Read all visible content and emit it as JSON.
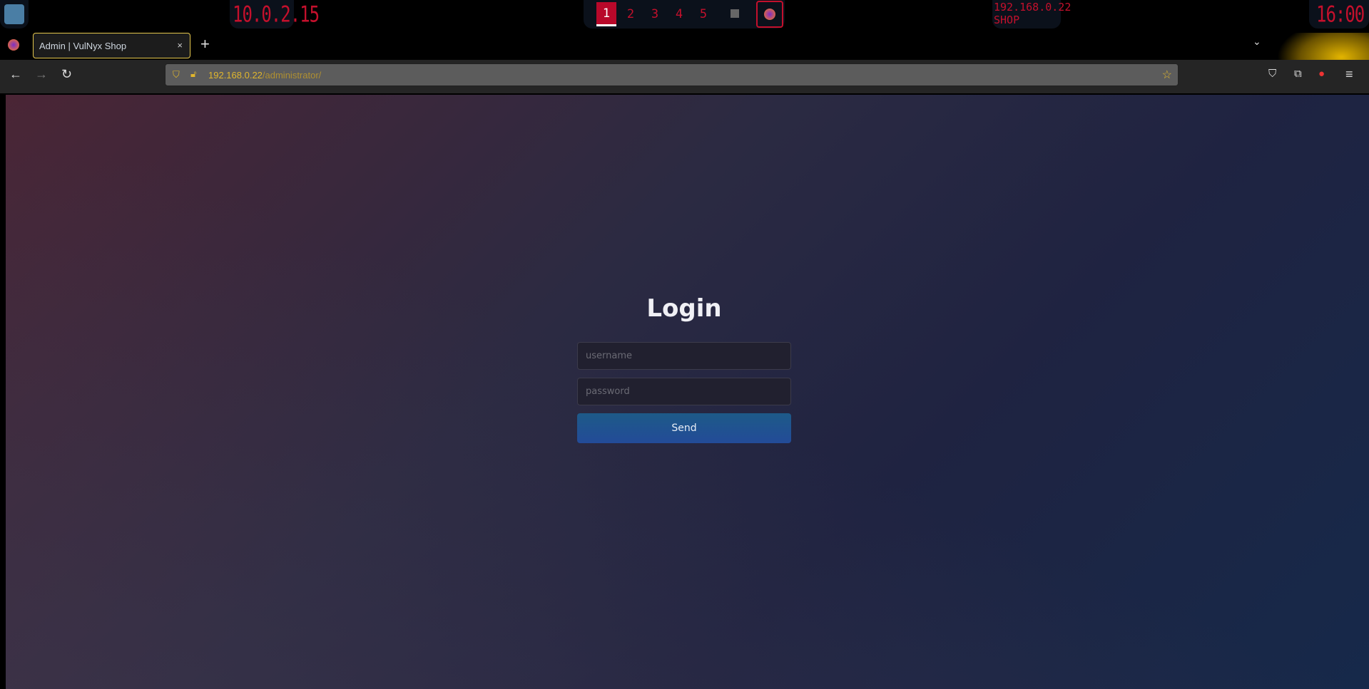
{
  "system_bar": {
    "ip": "10.0.2.15",
    "workspaces": [
      "1",
      "2",
      "3",
      "4",
      "5"
    ],
    "active_workspace": "1",
    "target": "192.168.0.22",
    "target_label": "SHOP",
    "clock": "16:00"
  },
  "browser": {
    "tab_title": "Admin | VulNyx Shop",
    "url_host": "192.168.0.22",
    "url_path": "/administrator/"
  },
  "page": {
    "title": "Login",
    "username_placeholder": "username",
    "password_placeholder": "password",
    "submit_label": "Send"
  },
  "colors": {
    "accent": "#c4102c",
    "button": "#1f5590"
  }
}
